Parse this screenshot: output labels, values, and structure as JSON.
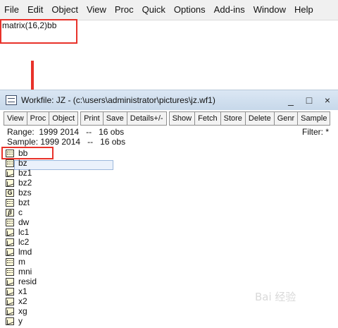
{
  "menubar": {
    "items": [
      "File",
      "Edit",
      "Object",
      "View",
      "Proc",
      "Quick",
      "Options",
      "Add-ins",
      "Window",
      "Help"
    ]
  },
  "command": {
    "text": "matrix(16,2)bb"
  },
  "workfile": {
    "title": "Workfile: JZ - (c:\\users\\administrator\\pictures\\jz.wf1)",
    "controls": [
      "_",
      "□",
      "×"
    ],
    "toolbar": [
      "View",
      "Proc",
      "Object",
      "Print",
      "Save",
      "Details+/-",
      "Show",
      "Fetch",
      "Store",
      "Delete",
      "Genr",
      "Sample"
    ],
    "range": "Range:  1999 2014   --   16 obs",
    "sample": "Sample: 1999 2014   --   16 obs",
    "filter": "Filter: *",
    "objects": [
      {
        "name": "bb",
        "icon": "vector-icon"
      },
      {
        "name": "bz",
        "icon": "vector-icon"
      },
      {
        "name": "bz1",
        "icon": "series-icon"
      },
      {
        "name": "bz2",
        "icon": "series-icon"
      },
      {
        "name": "bzs",
        "icon": "group-icon"
      },
      {
        "name": "bzt",
        "icon": "vector-icon"
      },
      {
        "name": "c",
        "icon": "coef-icon"
      },
      {
        "name": "dw",
        "icon": "vector-icon"
      },
      {
        "name": "lc1",
        "icon": "series-icon"
      },
      {
        "name": "lc2",
        "icon": "series-icon"
      },
      {
        "name": "lmd",
        "icon": "series-icon"
      },
      {
        "name": "m",
        "icon": "vector-icon"
      },
      {
        "name": "mni",
        "icon": "vector-icon"
      },
      {
        "name": "resid",
        "icon": "series-icon"
      },
      {
        "name": "x1",
        "icon": "series-icon"
      },
      {
        "name": "x2",
        "icon": "series-icon"
      },
      {
        "name": "xg",
        "icon": "series-icon"
      },
      {
        "name": "y",
        "icon": "series-icon"
      }
    ]
  },
  "highlight_color": "#e8322a",
  "watermark": "Bai 经验"
}
